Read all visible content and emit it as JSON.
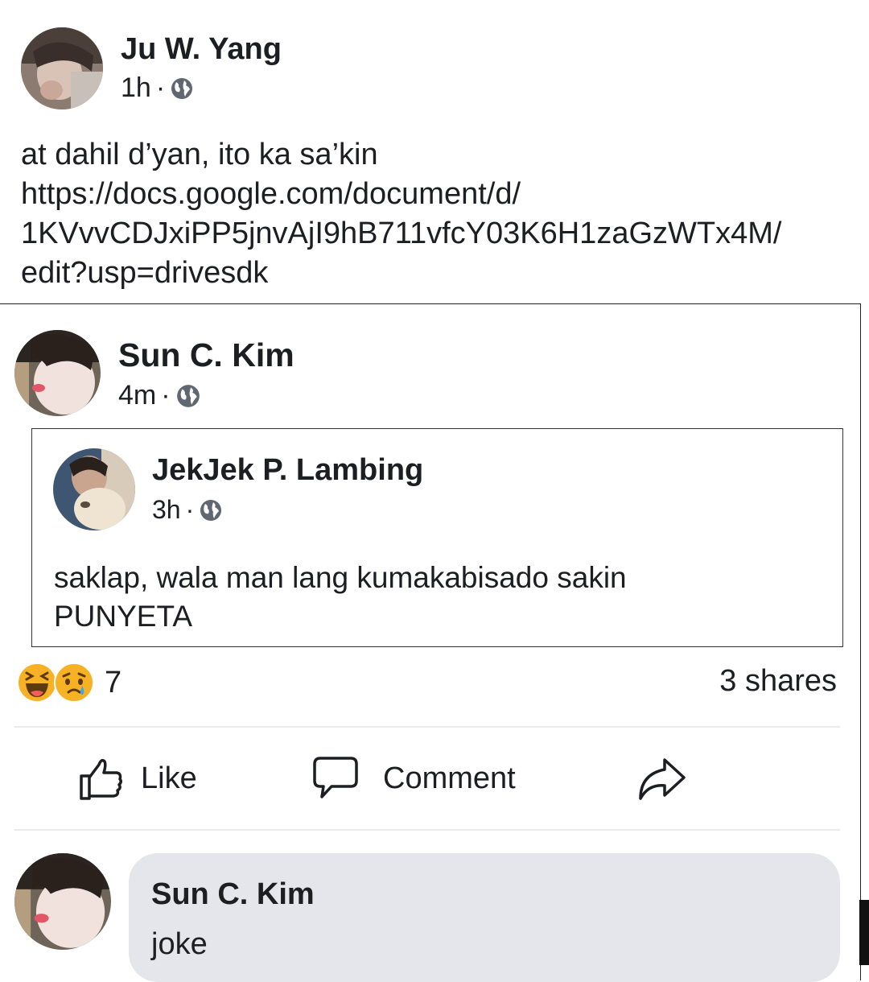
{
  "post": {
    "author": "Ju W. Yang",
    "time": "1h",
    "separator": "·",
    "privacy_icon": "globe-icon",
    "text_lines": [
      "at dahil d’yan, ito ka sa’kin",
      "https://docs.google.com/document/d/",
      "1KVvvCDJxiPP5jnvAjI9hB711vfcY03K6H1zaGzWTx4M/",
      "edit?usp=drivesdk"
    ]
  },
  "shared_post": {
    "author": "Sun C. Kim",
    "time": "4m",
    "separator": "·",
    "privacy_icon": "globe-icon",
    "inner": {
      "author": "JekJek P. Lambing",
      "time": "3h",
      "separator": "·",
      "privacy_icon": "globe-icon",
      "text_lines": [
        "saklap, wala man lang kumakabisado sakin",
        "PUNYETA"
      ]
    },
    "reactions": {
      "icons": [
        "haha-emoji",
        "sad-emoji"
      ],
      "count": "7",
      "shares": "3 shares"
    },
    "actions": {
      "like": "Like",
      "comment": "Comment"
    },
    "comment": {
      "author": "Sun C. Kim",
      "text": "joke"
    }
  },
  "colors": {
    "comment_bubble": "#e4e6eb",
    "emoji_yellow": "#f7b125",
    "tear_blue": "#4aa3ea"
  }
}
